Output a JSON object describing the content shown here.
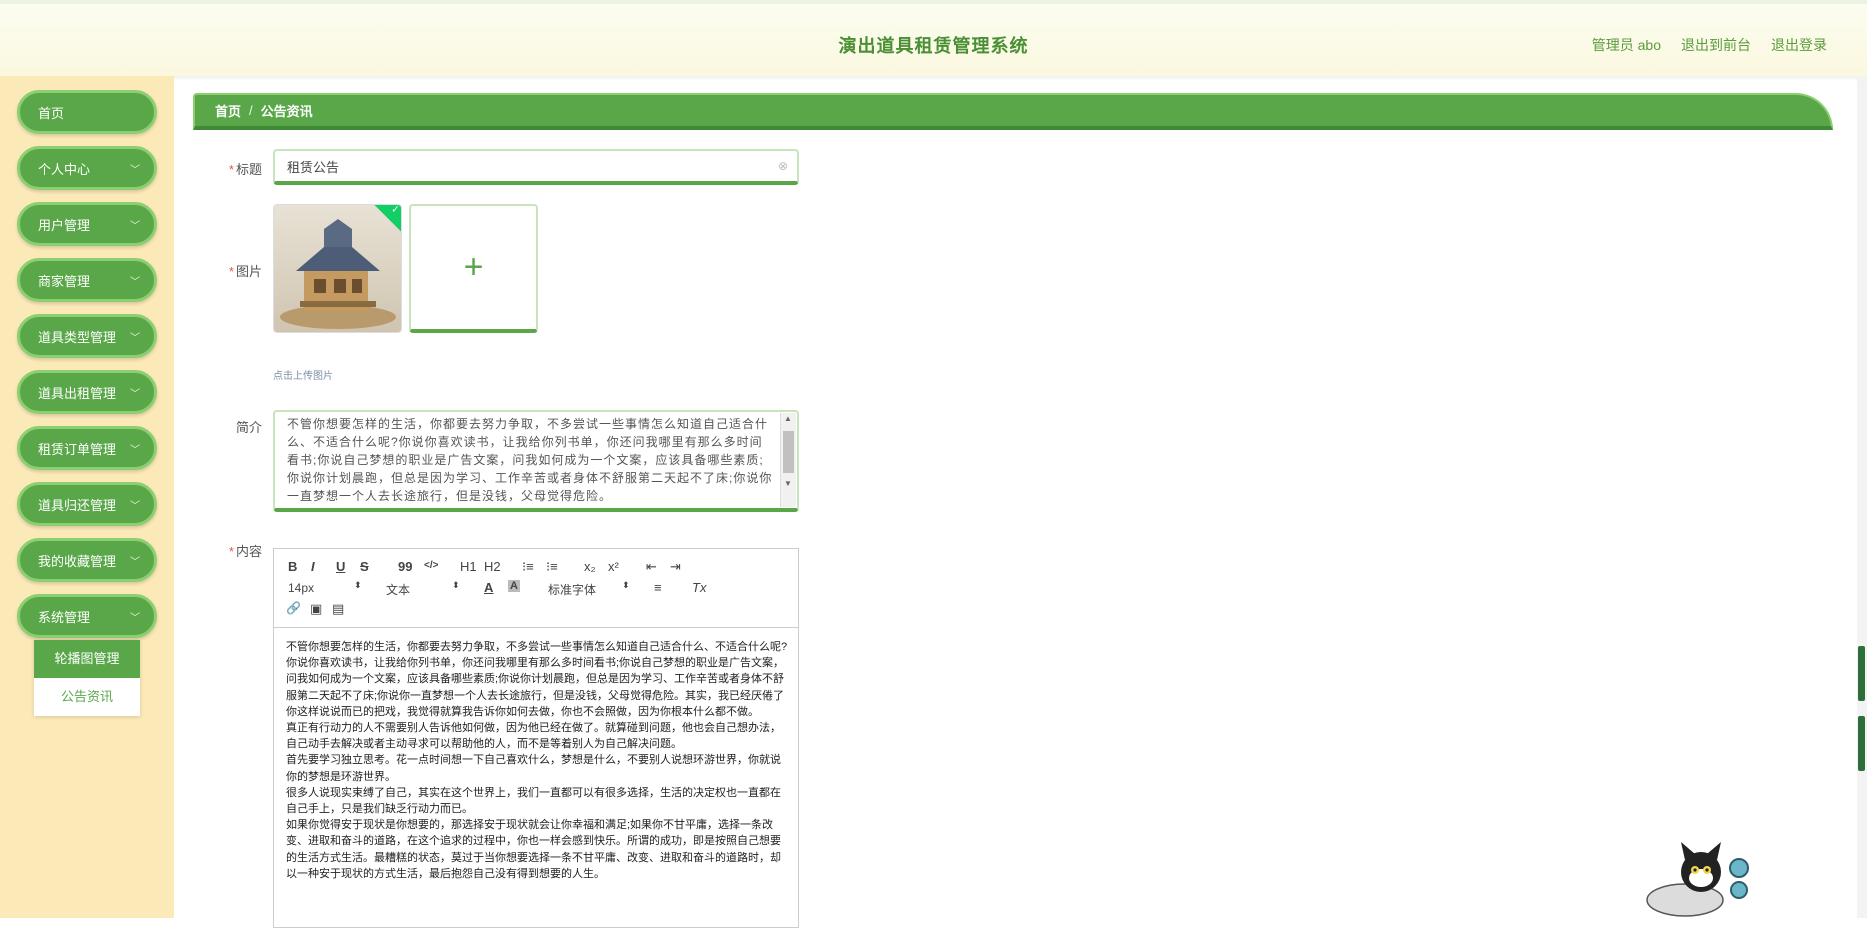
{
  "header": {
    "title": "演出道具租赁管理系统",
    "user": "管理员 abo",
    "to_front": "退出到前台",
    "logout": "退出登录"
  },
  "sidebar": {
    "items": [
      {
        "label": "首页"
      },
      {
        "label": "个人中心"
      },
      {
        "label": "用户管理"
      },
      {
        "label": "商家管理"
      },
      {
        "label": "道具类型管理"
      },
      {
        "label": "道具出租管理"
      },
      {
        "label": "租赁订单管理"
      },
      {
        "label": "道具归还管理"
      },
      {
        "label": "我的收藏管理"
      },
      {
        "label": "系统管理"
      }
    ],
    "submenu": [
      "轮播图管理",
      "公告资讯"
    ]
  },
  "breadcrumb": {
    "home": "首页",
    "sep": "/",
    "current": "公告资讯"
  },
  "form": {
    "title_label": "标题",
    "title_value": "租赁公告",
    "image_label": "图片",
    "upload_plus": "+",
    "upload_tip": "点击上传图片",
    "intro_label": "简介",
    "intro_value": "不管你想要怎样的生活，你都要去努力争取，不多尝试一些事情怎么知道自己适合什么、不适合什么呢?你说你喜欢读书，让我给你列书单，你还问我哪里有那么多时间看书;你说自己梦想的职业是广告文案，问我如何成为一个文案，应该具备哪些素质;你说你计划晨跑，但总是因为学习、工作辛苦或者身体不舒服第二天起不了床;你说你一直梦想一个人去长途旅行，但是没钱，父母觉得危险。",
    "content_label": "内容"
  },
  "editor": {
    "toolbar": {
      "bold": "B",
      "italic": "I",
      "underline": "U",
      "strike": "S",
      "quote": "99",
      "code": "</>",
      "h1": "H1",
      "h2": "H2",
      "ordered": "⁝≡",
      "bullet": "⁝≡",
      "sub": "x₂",
      "sup": "x²",
      "outdent": "⇤",
      "indent": "⇥",
      "size": "14px",
      "para": "文本",
      "color": "A",
      "bg": "A",
      "font": "标准字体",
      "align": "≡",
      "clean": "Tx",
      "link": "🔗",
      "image": "▣",
      "video": "▤"
    },
    "paragraphs": [
      "不管你想要怎样的生活，你都要去努力争取，不多尝试一些事情怎么知道自己适合什么、不适合什么呢?",
      "你说你喜欢读书，让我给你列书单，你还问我哪里有那么多时间看书;你说自己梦想的职业是广告文案，问我如何成为一个文案，应该具备哪些素质;你说你计划晨跑，但总是因为学习、工作辛苦或者身体不舒服第二天起不了床;你说你一直梦想一个人去长途旅行，但是没钱，父母觉得危险。其实，我已经厌倦了你这样说说而已的把戏，我觉得就算我告诉你如何去做，你也不会照做，因为你根本什么都不做。",
      "真正有行动力的人不需要别人告诉他如何做，因为他已经在做了。就算碰到问题，他也会自己想办法，自己动手去解决或者主动寻求可以帮助他的人，而不是等着别人为自己解决问题。",
      "首先要学习独立思考。花一点时间想一下自己喜欢什么，梦想是什么，不要别人说想环游世界，你就说你的梦想是环游世界。",
      "很多人说现实束缚了自己，其实在这个世界上，我们一直都可以有很多选择，生活的决定权也一直都在自己手上，只是我们缺乏行动力而已。",
      "如果你觉得安于现状是你想要的，那选择安于现状就会让你幸福和满足;如果你不甘平庸，选择一条改变、进取和奋斗的道路，在这个追求的过程中，你也一样会感到快乐。所谓的成功，即是按照自己想要的生活方式生活。最糟糕的状态，莫过于当你想要选择一条不甘平庸、改变、进取和奋斗的道路时，却以一种安于现状的方式生活，最后抱怨自己没有得到想要的人生。"
    ]
  },
  "colors": {
    "accent": "#5aa74a",
    "sidebar_bg": "#fbe9b8",
    "header_text": "#4a8f34"
  }
}
